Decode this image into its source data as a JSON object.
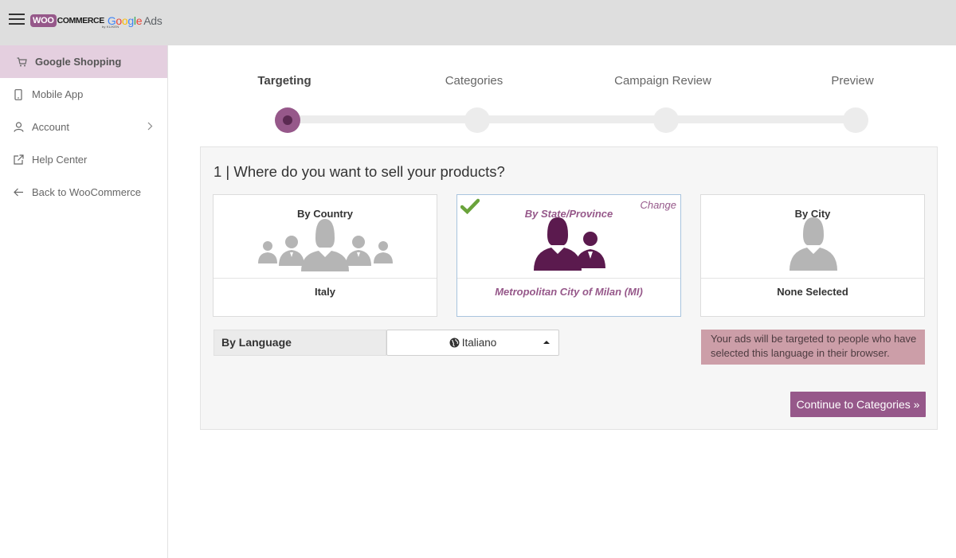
{
  "header": {
    "brand_woo": "WOO",
    "brand_commerce": "COMMERCE",
    "brand_google": [
      "G",
      "o",
      "o",
      "g",
      "l",
      "e"
    ],
    "brand_ads": "Ads",
    "brand_sub": "by KLIKEN",
    "menu_icon": "hamburger-icon"
  },
  "sidebar": {
    "items": [
      {
        "label": "Google Shopping",
        "icon": "cart-icon",
        "active": true
      },
      {
        "label": "Mobile App",
        "icon": "mobile-icon"
      },
      {
        "label": "Account",
        "icon": "user-icon",
        "has_submenu": true
      },
      {
        "label": "Help Center",
        "icon": "external-link-icon"
      },
      {
        "label": "Back to WooCommerce",
        "icon": "arrow-left-icon"
      }
    ]
  },
  "steps": [
    {
      "label": "Targeting",
      "active": true
    },
    {
      "label": "Categories"
    },
    {
      "label": "Campaign Review"
    },
    {
      "label": "Preview"
    }
  ],
  "panel": {
    "question": "1 | Where do you want to sell your products?",
    "cards": [
      {
        "title": "By Country",
        "value": "Italy",
        "selected": false,
        "icon": "group-people-icon"
      },
      {
        "title": "By State/Province",
        "value": "Metropolitan City of Milan (MI)",
        "selected": true,
        "change_label": "Change",
        "icon": "two-people-icon"
      },
      {
        "title": "By City",
        "value": "None Selected",
        "selected": false,
        "icon": "person-icon"
      }
    ],
    "language": {
      "label": "By Language",
      "selected": "Italiano"
    },
    "info": "Your ads will be targeted to people who have selected this language in their browser.",
    "continue_label": "Continue to Categories »"
  },
  "colors": {
    "accent": "#96588a",
    "accent_dark": "#5b2a52",
    "sidebar_active": "#e4cfdf",
    "info_bg": "#cc9ea8",
    "check": "#6aa33b",
    "figure_gray": "#b5b5b5"
  }
}
